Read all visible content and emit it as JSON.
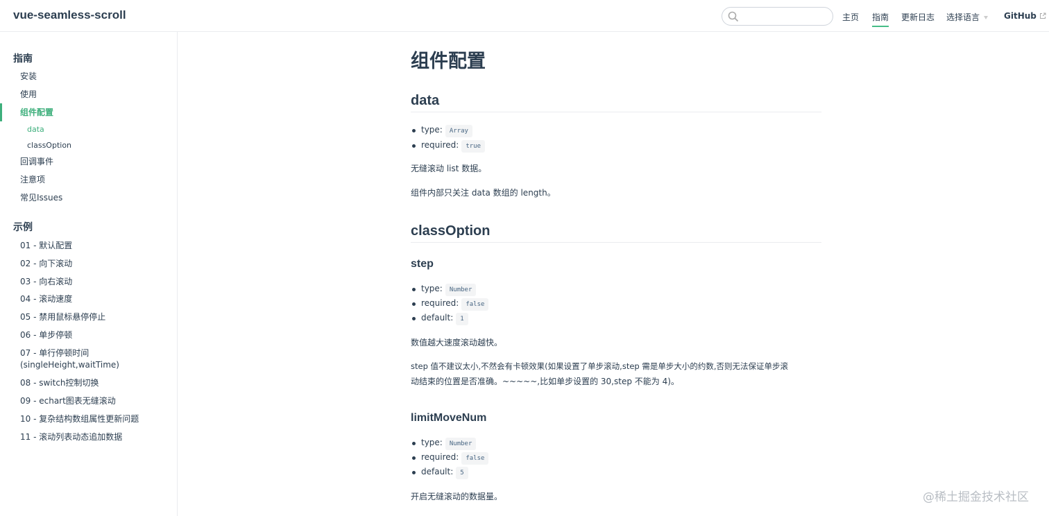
{
  "navbar": {
    "site_name": "vue-seamless-scroll",
    "search": {
      "value": "",
      "placeholder": ""
    },
    "links": [
      "主页",
      "指南",
      "更新日志",
      "选择语言",
      "GitHub"
    ]
  },
  "sidebar": {
    "groups": [
      {
        "title": "指南",
        "items": [
          "安装",
          "使用",
          "组件配置",
          "回调事件",
          "注意项",
          "常见Issues"
        ],
        "sub_items": [
          "data",
          "classOption"
        ]
      },
      {
        "title": "示例",
        "items": [
          "01 - 默认配置",
          "02 - 向下滚动",
          "03 - 向右滚动",
          "04 - 滚动速度",
          "05 - 禁用鼠标悬停停止",
          "06 - 单步停顿",
          "07 - 单行停顿时间",
          "(singleHeight,waitTime)",
          "08 - switch控制切换",
          "09 - echart图表无缝滚动",
          "10 - 复杂结构数组属性更新问题",
          "11 - 滚动列表动态追加数据"
        ]
      }
    ]
  },
  "content": {
    "title": "组件配置",
    "data_section": {
      "heading": "data",
      "props": [
        {
          "key": "type:",
          "value": "Array"
        },
        {
          "key": "required:",
          "value": "true"
        }
      ],
      "p1": "无缝滚动 list 数据。",
      "p2": "组件内部只关注 data 数组的 length。"
    },
    "class_option": {
      "heading": "classOption",
      "step": {
        "heading": "step",
        "props": [
          {
            "key": "type:",
            "value": "Number"
          },
          {
            "key": "required:",
            "value": "false"
          },
          {
            "key": "default:",
            "value": "1"
          }
        ],
        "p1": "数值越大速度滚动越快。",
        "p2a": "step 值不建议太小,不然会有卡顿效果(如果设置了单步滚动,step 需是单步大小的约数,否则无法保证单步滚",
        "p2b": "动结束的位置是否准确。~~~~~,比如单步设置的 30,step 不能为 4)。"
      },
      "limit": {
        "heading": "limitMoveNum",
        "props": [
          {
            "key": "type:",
            "value": "Number"
          },
          {
            "key": "required:",
            "value": "false"
          },
          {
            "key": "default:",
            "value": "5"
          }
        ],
        "p1": "开启无缝滚动的数据量。"
      }
    }
  },
  "watermark": "@稀土掘金技术社区",
  "colors": {
    "accent": "#3eaf7c",
    "text": "#2c3e50",
    "border": "#eaecef"
  }
}
